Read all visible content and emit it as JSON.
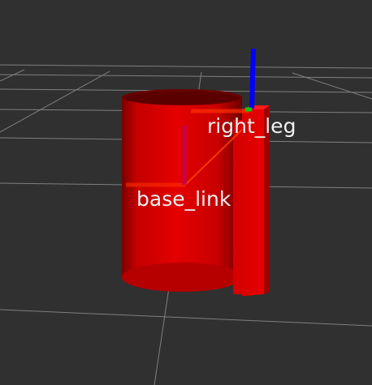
{
  "viewport": {
    "background_color": "#303030",
    "grid_color": "#a0a0a0",
    "model_color": "#e00000"
  },
  "frames": {
    "right_leg": {
      "label": "right_leg",
      "axes": [
        "x-axis-red",
        "y-axis-green",
        "z-axis-blue"
      ]
    },
    "base_link": {
      "label": "base_link",
      "axes": [
        "x-axis-red",
        "y-axis-green",
        "z-axis-blue"
      ]
    }
  },
  "links": [
    {
      "name": "base-link-cylinder",
      "shape": "cylinder"
    },
    {
      "name": "right-leg-box",
      "shape": "box"
    }
  ]
}
